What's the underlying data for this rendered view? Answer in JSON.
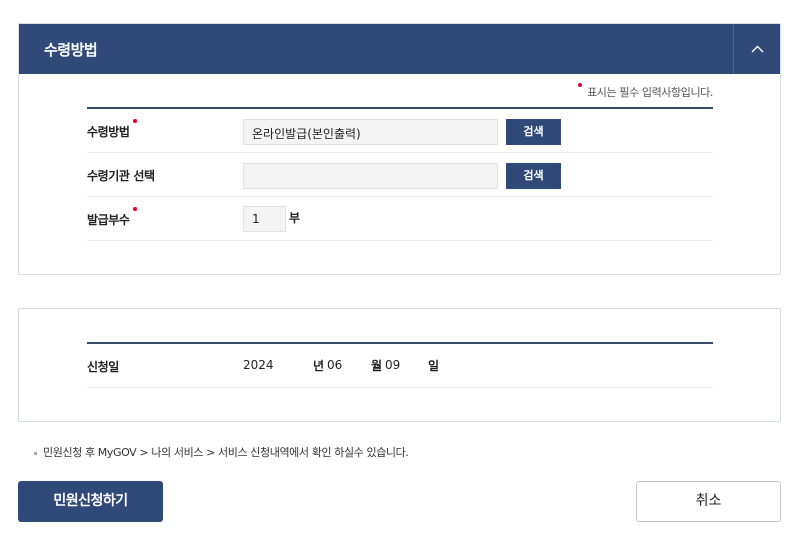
{
  "section": {
    "title": "수령방법",
    "required_note": "표시는 필수 입력사항입니다."
  },
  "form": {
    "receipt_method": {
      "label": "수령방법",
      "value": "온라인발급(본인출력)",
      "button": "검색"
    },
    "receiving_agency": {
      "label": "수령기관 선택",
      "value": "",
      "button": "검색"
    },
    "copies": {
      "label": "발급부수",
      "value": "1",
      "unit": "부"
    }
  },
  "application_date": {
    "label": "신청일",
    "year": "2024",
    "year_unit": "년",
    "month": "06",
    "month_unit": "월",
    "day": "09",
    "day_unit": "일"
  },
  "notice": "민원신청 후 MyGOV > 나의 서비스 > 서비스 신청내역에서 확인 하실수 있습니다.",
  "actions": {
    "submit": "민원신청하기",
    "cancel": "취소"
  },
  "icons": {
    "collapse": "chevron-up-icon",
    "required": "required-dot-icon"
  },
  "colors": {
    "primary": "#2f4a78",
    "required": "#e4002b"
  }
}
